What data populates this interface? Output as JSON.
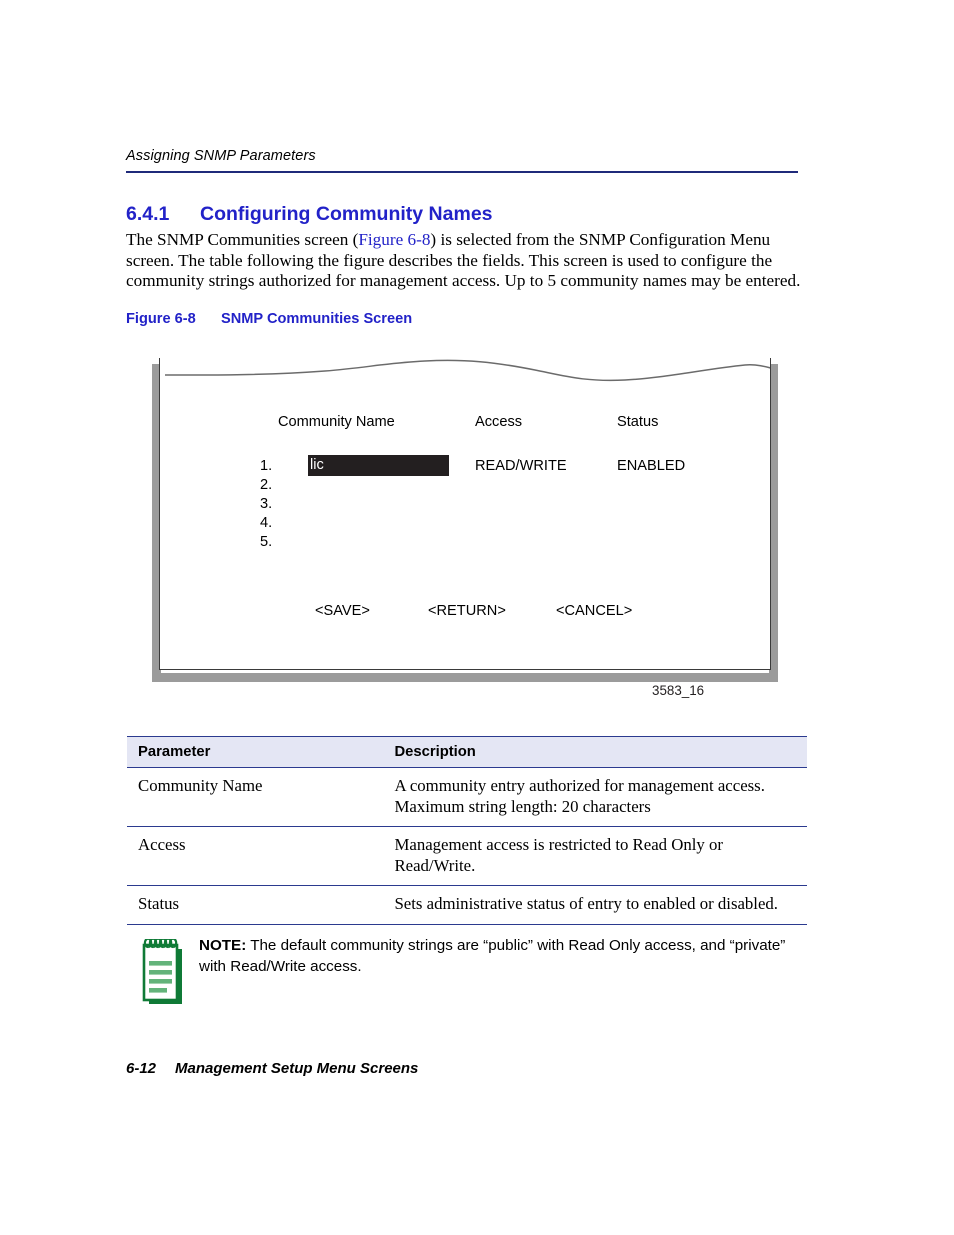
{
  "header": {
    "running_title": "Assigning SNMP Parameters",
    "rule_color": "#1f2a7a"
  },
  "section": {
    "number": "6.4.1",
    "title": "Configuring Community Names",
    "heading_color": "#2222c8"
  },
  "body": {
    "part1": "The SNMP Communities screen (",
    "xref": "Figure 6-8",
    "part2": ") is selected from the SNMP Configuration Menu screen. The table following the figure describes the fields. This screen is used to configure the community strings authorized for management access. Up to 5 community names may be entered."
  },
  "figure": {
    "caption_label": "Figure 6-8",
    "caption_title": "SNMP Communities Screen",
    "figure_id": "3583_16",
    "screen": {
      "columns": {
        "community_name": "Community Name",
        "access": "Access",
        "status": "Status"
      },
      "entries": [
        {
          "index": "1.",
          "community_name": "lic",
          "access": "READ/WRITE",
          "status": "ENABLED",
          "highlighted": "true"
        },
        {
          "index": "2.",
          "community_name": "",
          "access": "",
          "status": ""
        },
        {
          "index": "3.",
          "community_name": "",
          "access": "",
          "status": ""
        },
        {
          "index": "4.",
          "community_name": "",
          "access": "",
          "status": ""
        },
        {
          "index": "5.",
          "community_name": "",
          "access": "",
          "status": ""
        }
      ],
      "actions": {
        "save": "<SAVE>",
        "return": "<RETURN>",
        "cancel": "<CANCEL>"
      },
      "field_highlight_color": "#231f20",
      "frame_color": "#9b9b9b"
    }
  },
  "param_table": {
    "headers": {
      "parameter": "Parameter",
      "description": "Description"
    },
    "header_bg": "#e4e6f4",
    "rule_color": "#2b3a8f",
    "rows": [
      {
        "parameter": "Community Name",
        "description_line1": "A community entry authorized for management access.",
        "description_line2": "Maximum string length: 20 characters"
      },
      {
        "parameter": "Access",
        "description_line1": "Management access is restricted to Read Only or",
        "description_line2": "Read/Write."
      },
      {
        "parameter": "Status",
        "description_line1": "Sets administrative status of entry to enabled or disabled.",
        "description_line2": ""
      }
    ]
  },
  "note": {
    "label": "NOTE:",
    "text": "The default community strings are “public” with Read Only access, and “private” with Read/Write access.",
    "icon_border_color": "#0f7a36",
    "icon_line_color": "#63b37a"
  },
  "footer": {
    "page_number": "6-12",
    "title": "Management Setup Menu Screens"
  }
}
